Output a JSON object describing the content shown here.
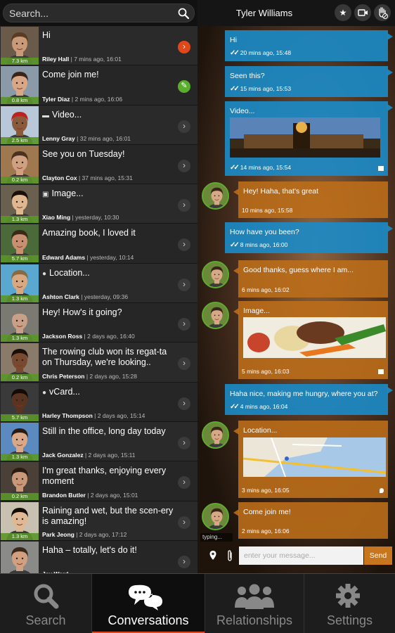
{
  "search": {
    "placeholder": "Search..."
  },
  "conversations": [
    {
      "name": "Riley Hall",
      "time": "7 mins ago, 16:01",
      "message": "Hi",
      "distance": "7.3 km",
      "indicator": "unread",
      "skin": "#c99a78",
      "hair": "#5a3a22",
      "bg": "#6a5a4a"
    },
    {
      "name": "Tyler Diaz",
      "time": "2 mins ago, 16:06",
      "message": "Come join me!",
      "distance": "0.8 km",
      "indicator": "writing",
      "skin": "#d8a886",
      "hair": "#3a2618",
      "bg": "#8a9aa8"
    },
    {
      "name": "Lenny Gray",
      "time": "32 mins ago, 16:01",
      "message": "Video...",
      "distance": "2.5 km",
      "indicator": "chevron",
      "icon": "video",
      "skin": "#8a5a3a",
      "hair": "#c02020",
      "bg": "#b8c8d8"
    },
    {
      "name": "Clayton Cox",
      "time": "37 mins ago, 15:31",
      "message": "See you on Tuesday!",
      "distance": "0.2 km",
      "indicator": "chevron",
      "skin": "#d0a080",
      "hair": "#4a3020",
      "bg": "#a07850"
    },
    {
      "name": "Xiao Ming",
      "time": "yesterday, 10:30",
      "message": "Image...",
      "distance": "1.3 km",
      "indicator": "chevron",
      "icon": "image",
      "skin": "#e0b890",
      "hair": "#1a1008",
      "bg": "#6a6050"
    },
    {
      "name": "Edward Adams",
      "time": "yesterday, 10:14",
      "message": "Amazing book, I loved it",
      "distance": "5.7 km",
      "indicator": "chevron",
      "skin": "#c89070",
      "hair": "#3a2818",
      "bg": "#4a6a3a"
    },
    {
      "name": "Ashton Clark",
      "time": "yesterday, 09:36",
      "message": "Location...",
      "distance": "1.3 km",
      "indicator": "chevron",
      "icon": "location",
      "skin": "#d8a880",
      "hair": "#8a6a40",
      "bg": "#5aa8d0"
    },
    {
      "name": "Jackson Ross",
      "time": "2 days ago, 16:40",
      "message": "Hey!  How's it going?",
      "distance": "1.3 km",
      "indicator": "chevron",
      "skin": "#c8a088",
      "hair": "#7a7870",
      "bg": "#7a7a72"
    },
    {
      "name": "Chris Peterson",
      "time": "2 days ago, 15:28",
      "message": "The rowing club won its regat-ta on Thursday, we're looking..",
      "distance": "0.2 km",
      "indicator": "chevron",
      "skin": "#7a4a30",
      "hair": "#1a0e08",
      "bg": "#8a7a6a"
    },
    {
      "name": "Harley Thompson",
      "time": "2 days ago, 15:14",
      "message": "vCard...",
      "distance": "5.7 km",
      "indicator": "chevron",
      "icon": "person",
      "skin": "#5a3420",
      "hair": "#140a06",
      "bg": "#3a3a3a"
    },
    {
      "name": "Jack Gonzalez",
      "time": "2 days ago, 15:11",
      "message": "Still in the office, long day today",
      "distance": "1.3 km",
      "indicator": "chevron",
      "skin": "#d8a888",
      "hair": "#2a1a10",
      "bg": "#5a8ac0"
    },
    {
      "name": "Brandon Butler",
      "time": "2 days ago, 15:01",
      "message": "I'm great thanks, enjoying every moment",
      "distance": "0.2 km",
      "indicator": "chevron",
      "skin": "#c89878",
      "hair": "#2a1a10",
      "bg": "#4a4038"
    },
    {
      "name": "Park Jeong",
      "time": "2 days ago, 17:12",
      "message": "Raining and wet, but the scen-ery is amazing!",
      "distance": "1.3 km",
      "indicator": "chevron",
      "skin": "#e0b894",
      "hair": "#140c06",
      "bg": "#c8c0b0"
    },
    {
      "name": "Jay Ward",
      "time": "",
      "message": "Haha – totally, let's do it!",
      "distance": "",
      "indicator": "chevron",
      "skin": "#d0a080",
      "hair": "#3a2818",
      "bg": "#8a8a88"
    }
  ],
  "chat": {
    "contact_name": "Tyler Williams",
    "messages": [
      {
        "dir": "out",
        "text": "Hi",
        "time": "20 mins ago, 15:48"
      },
      {
        "dir": "out",
        "text": "Seen this?",
        "time": "15 mins ago, 15:53"
      },
      {
        "dir": "out",
        "text": "Video...",
        "time": "14 mins ago, 15:54",
        "media": "video"
      },
      {
        "dir": "in",
        "text": "Hey!  Haha, that's great",
        "time": "10 mins ago, 15:58"
      },
      {
        "dir": "out",
        "text": "How have you been?",
        "time": "8 mins ago, 16:00"
      },
      {
        "dir": "in",
        "text": "Good thanks, guess where I am...",
        "time": "6 mins ago, 16:02"
      },
      {
        "dir": "in",
        "text": "Image...",
        "time": "5 mins ago, 16:03",
        "media": "image"
      },
      {
        "dir": "out",
        "text": "Haha nice, making me hungry, where you at?",
        "time": "4 mins ago, 16:04"
      },
      {
        "dir": "in",
        "text": "Location...",
        "time": "3 mins ago, 16:05",
        "media": "map"
      },
      {
        "dir": "in",
        "text": "Come join me!",
        "time": "2 mins ago, 16:06"
      }
    ],
    "typing": "typing...",
    "message_placeholder": "enter your message...",
    "send_label": "Send"
  },
  "nav": {
    "tabs": [
      {
        "label": "Search",
        "icon": "search-icon"
      },
      {
        "label": "Conversations",
        "icon": "chat-bubbles-icon",
        "active": true
      },
      {
        "label": "Relationships",
        "icon": "people-icon"
      },
      {
        "label": "Settings",
        "icon": "gear-icon"
      }
    ]
  },
  "colors": {
    "outgoing": "#1c8ac4",
    "incoming": "#be6e19",
    "accent": "#e0481a",
    "distance_bar": "#5a962a"
  }
}
